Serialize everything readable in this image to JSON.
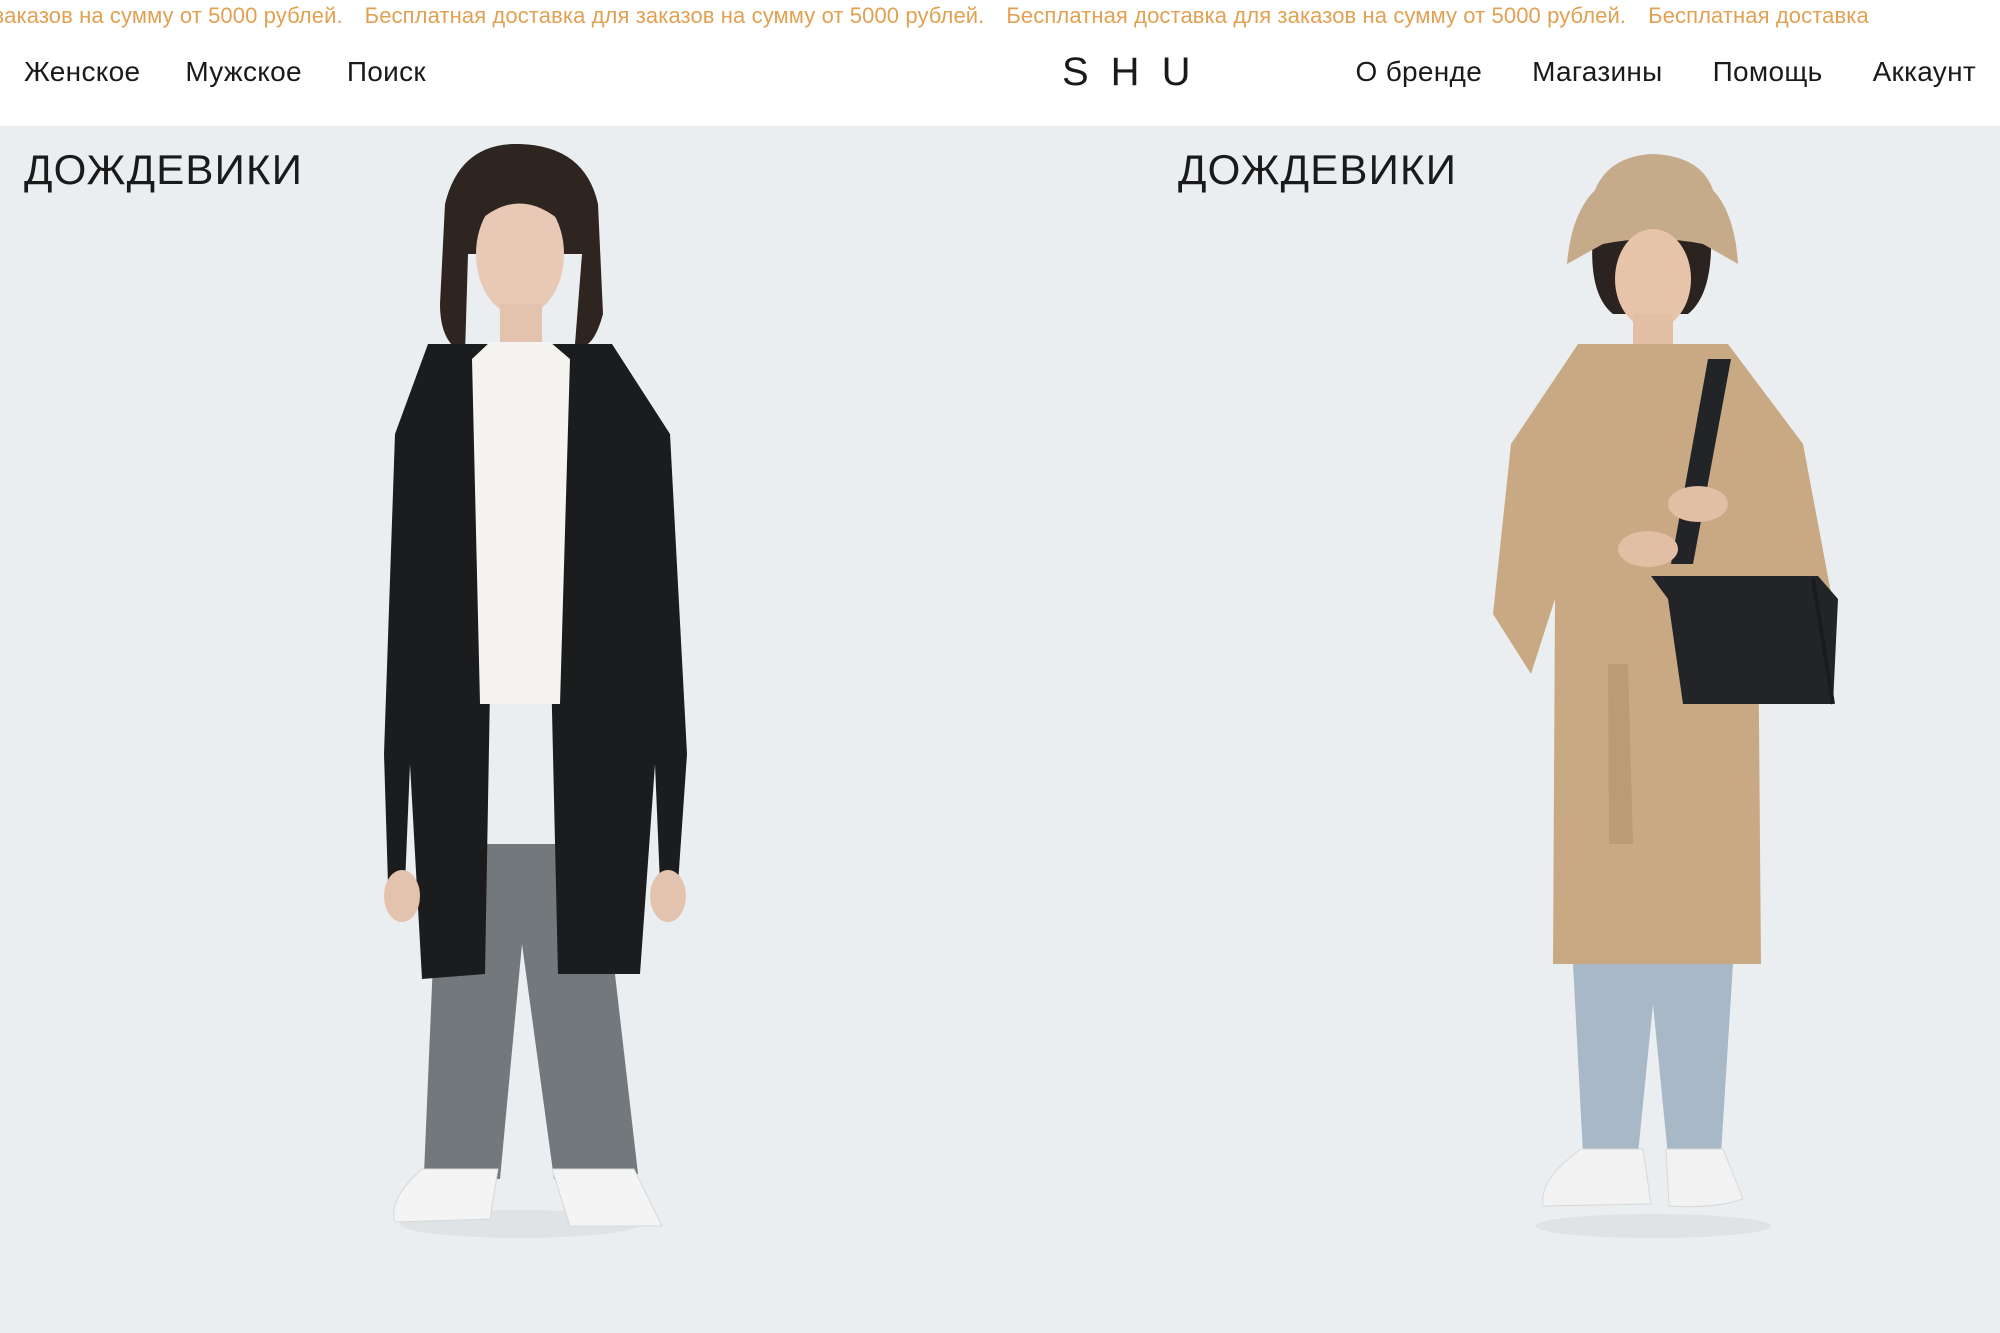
{
  "announcement": {
    "items": [
      "заказов на сумму от 5000 рублей.",
      "Бесплатная доставка для заказов на сумму от 5000 рублей.",
      "Бесплатная доставка для заказов на сумму от 5000 рублей.",
      "Бесплатная доставка"
    ],
    "color": "#e2a052"
  },
  "header": {
    "nav_left": [
      "Женское",
      "Мужское",
      "Поиск"
    ],
    "logo": "SHU",
    "nav_right": [
      "О бренде",
      "Магазины",
      "Помощь",
      "Аккаунт"
    ]
  },
  "products": [
    {
      "title": "ДОЖДЕВИКИ",
      "coat_color": "#1b1c1e"
    },
    {
      "title": "ДОЖДЕВИКИ",
      "coat_color": "#c9a983"
    }
  ],
  "colors": {
    "background": "#ebeef0",
    "text": "#1a1a1a"
  }
}
